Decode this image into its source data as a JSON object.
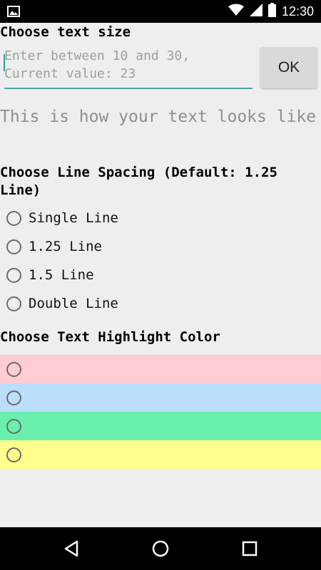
{
  "status_bar": {
    "time": "12:30",
    "icons": [
      "image-icon",
      "wifi-icon",
      "signal-icon",
      "battery-icon"
    ]
  },
  "text_size": {
    "title": "Choose text size",
    "input_placeholder": "Enter between 10 and 30,\nCurrent value: 23",
    "input_value": "",
    "ok_label": "OK"
  },
  "preview": {
    "text": "This is how your text looks like"
  },
  "line_spacing": {
    "title": "Choose Line Spacing (Default: 1.25 Line)",
    "options": [
      {
        "label": "Single Line",
        "selected": false
      },
      {
        "label": "1.25 Line",
        "selected": false
      },
      {
        "label": "1.5 Line",
        "selected": false
      },
      {
        "label": "Double Line",
        "selected": false
      }
    ]
  },
  "highlight": {
    "title": "Choose Text Highlight Color",
    "options": [
      {
        "color": "#ffcdd2",
        "selected": false
      },
      {
        "color": "#bbdefb",
        "selected": false
      },
      {
        "color": "#69f0ae",
        "selected": false
      },
      {
        "color": "#ffff8d",
        "selected": false
      }
    ]
  },
  "nav_bar": {
    "icons": [
      "back-icon",
      "home-icon",
      "recents-icon"
    ]
  },
  "colors": {
    "background": "#eeeeee",
    "accent": "#4aa9a0"
  }
}
